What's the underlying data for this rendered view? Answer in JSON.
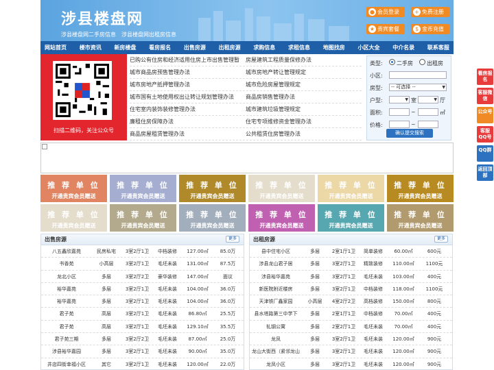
{
  "header": {
    "title": "涉县楼盘网",
    "subtitle": "涉县楼盘网二手房信息　涉县楼盘网出租房信息",
    "buttons": [
      {
        "label": "会员登录",
        "icon": "user-icon"
      },
      {
        "label": "免费注册",
        "icon": "user-add-icon"
      },
      {
        "label": "贵宾套餐",
        "icon": "vip-icon"
      },
      {
        "label": "金币充值",
        "icon": "coin-icon"
      }
    ]
  },
  "nav": [
    "网站首页",
    "楼市资讯",
    "新房楼盘",
    "看房报名",
    "出售房源",
    "出租房源",
    "求购信息",
    "求租信息",
    "地图找房",
    "小区大全",
    "中介名录",
    "联系客服"
  ],
  "qr": {
    "caption": "扫描二维码，关注公众号"
  },
  "news": [
    [
      "已购公有住房和经济适用住房上市出售管理暂",
      "房屋建筑工程质量保修办法"
    ],
    [
      "城市商品房预售管理办法",
      "城市房地产转让管理规定"
    ],
    [
      "城市房地产抵押管理办法",
      "城市危险房屋管理规定"
    ],
    [
      "城市国有土地使用权出让转让规划管理办法",
      "商品房销售管理办法"
    ],
    [
      "住宅室内装饰装修管理办法",
      "城市建筑垃圾管理规定"
    ],
    [
      "廉租住房保障办法",
      "住宅专项维修资金管理办法"
    ],
    [
      "商品房屋租赁管理办法",
      "公共租赁住房管理办法"
    ]
  ],
  "search": {
    "type_label": "类型:",
    "opt_sale": "二手房",
    "opt_rent": "出租房",
    "community_label": "小区:",
    "house_type_label": "房型:",
    "house_type_value": "-- 可选择 --",
    "layout_label": "户型:",
    "room_unit": "室",
    "hall_unit": "厅",
    "area_label": "面积:",
    "area_unit": "㎡",
    "price_label": "价格:",
    "submit_label": "确认提交搜索"
  },
  "ads": {
    "line1": "推 荐 单 位",
    "line2": "开通贵宾会员赠送",
    "colors": [
      "#e18461",
      "#a5aed0",
      "#b08a2a",
      "#e5ddcc",
      "#ecd7a6",
      "#b88a22",
      "#e5ddcc",
      "#b3a98c",
      "#a3aebd",
      "#c060b0",
      "#56a7b0",
      "#b09a6e"
    ]
  },
  "sale": {
    "title": "出售房源",
    "more": "更多",
    "rows": [
      [
        "八五鑫欣嘉苑",
        "民房私宅",
        "3室2厅1卫",
        "中档装修",
        "127.00㎡",
        "85.0万"
      ],
      [
        "书香苑",
        "小高层",
        "3室2厅1卫",
        "毛坯未装",
        "131.00㎡",
        "87.5万"
      ],
      [
        "龙北小区",
        "多层",
        "3室2厅2卫",
        "豪华装修",
        "147.00㎡",
        "面议"
      ],
      [
        "裕华嘉苑",
        "多层",
        "3室2厅1卫",
        "毛坯未装",
        "104.00㎡",
        "36.0万"
      ],
      [
        "裕华嘉苑",
        "多层",
        "3室2厅1卫",
        "毛坯未装",
        "104.00㎡",
        "36.0万"
      ],
      [
        "君子苑",
        "高层",
        "3室2厅1卫",
        "毛坯未装",
        "86.80㎡",
        "25.5万"
      ],
      [
        "君子苑",
        "高层",
        "3室2厅1卫",
        "毛坯未装",
        "129.10㎡",
        "35.5万"
      ],
      [
        "君子苑三期",
        "多层",
        "3室2厅2卫",
        "毛坯未装",
        "87.00㎡",
        "25.0万"
      ],
      [
        "涉县裕华嘉园",
        "多层",
        "3室2厅1卫",
        "毛坯未装",
        "90.00㎡",
        "35.0万"
      ],
      [
        "井店四街幸福小区",
        "其它",
        "3室2厅1卫",
        "毛坯未装",
        "120.00㎡",
        "22.0万"
      ]
    ]
  },
  "rent": {
    "title": "出租房源",
    "more": "更多",
    "rows": [
      [
        "县中住宅小区",
        "多层",
        "2室1厅1卫",
        "简单装修",
        "60.00㎡",
        "600元"
      ],
      [
        "涉县龙山君子居",
        "多层",
        "3室2厅1卫",
        "精致装修",
        "110.00㎡",
        "1100元"
      ],
      [
        "涉县裕华嘉苑",
        "多层",
        "3室2厅1卫",
        "毛坯未装",
        "103.00㎡",
        "400元"
      ],
      [
        "新医院附近楼房",
        "多层",
        "3室2厅1卫",
        "中档装修",
        "118.00㎡",
        "1100元"
      ],
      [
        "天津铁厂鑫家园",
        "小高层",
        "4室2厅2卫",
        "高档装修",
        "150.00㎡",
        "800元"
      ],
      [
        "县水塔路第三中学下",
        "多层",
        "2室1厅1卫",
        "中档装修",
        "70.00㎡",
        "400元"
      ],
      [
        "轧钢公寓",
        "多层",
        "2室2厅1卫",
        "毛坯未装",
        "70.00㎡",
        "400元"
      ],
      [
        "龙凤",
        "多层",
        "3室2厅1卫",
        "毛坯未装",
        "120.00㎡",
        "900元"
      ],
      [
        "龙山大街西（紧邻龙山",
        "多层",
        "3室2厅1卫",
        "毛坯未装",
        "120.00㎡",
        "900元"
      ],
      [
        "龙凤小区",
        "多层",
        "3室2厅1卫",
        "毛坯未装",
        "120.00㎡",
        "900元"
      ]
    ]
  },
  "side": [
    {
      "label": "看房报名",
      "color": "#e83c3c"
    },
    {
      "label": "客服微信",
      "color": "#e83c3c"
    },
    {
      "label": "公众号",
      "color": "#f08a24"
    },
    {
      "label": "客服QQ号",
      "color": "#e83c3c"
    },
    {
      "label": "QQ群",
      "color": "#2d72c0"
    },
    {
      "label": "返回顶部",
      "color": "#2d72c0"
    }
  ]
}
